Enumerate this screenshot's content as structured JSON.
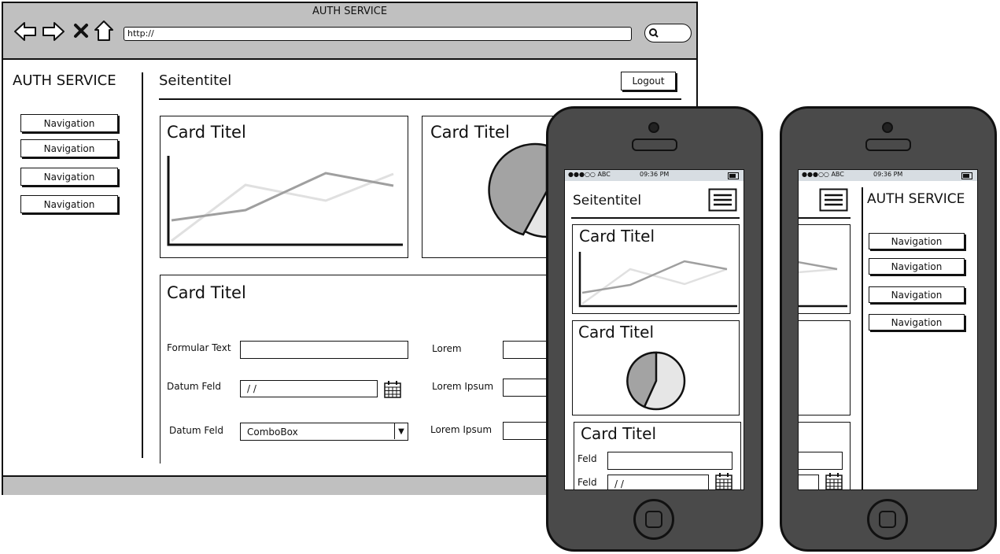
{
  "browser": {
    "window_title": "AUTH SERVICE",
    "url": "http://",
    "toolbar_icons": [
      "back-arrow-icon",
      "forward-arrow-icon",
      "close-x-icon",
      "home-icon",
      "search-icon"
    ]
  },
  "desktop": {
    "app_title": "AUTH SERVICE",
    "page_title": "Seitentitel",
    "logout_label": "Logout",
    "nav_items": [
      "Navigation",
      "Navigation",
      "Navigation",
      "Navigation"
    ],
    "line_card": {
      "title": "Card Titel"
    },
    "pie_card": {
      "title": "Card Titel"
    },
    "form_card": {
      "title": "Card Titel",
      "left_fields": [
        {
          "label": "Formular Text",
          "value": ""
        },
        {
          "label": "Datum Feld",
          "value": "/ /"
        },
        {
          "label": "Datum Feld",
          "value": "ComboBox"
        }
      ],
      "right_fields": [
        {
          "label": "Lorem",
          "value": ""
        },
        {
          "label": "Lorem Ipsum",
          "value": ""
        },
        {
          "label": "Lorem Ipsum",
          "value": ""
        }
      ]
    }
  },
  "phone1": {
    "status": {
      "carrier": "●●●○○ ABC",
      "time": "09:36 PM"
    },
    "page_title": "Seitentitel",
    "cards": [
      "Card Titel",
      "Card Titel",
      "Card Titel"
    ],
    "fields": [
      {
        "label": "Feld",
        "value": ""
      },
      {
        "label": "Feld",
        "value": "/ /"
      }
    ]
  },
  "phone2": {
    "status": {
      "carrier": "●●●○○ ABC",
      "time": "09:36 PM"
    },
    "app_title": "AUTH SERVICE",
    "nav_items": [
      "Navigation",
      "Navigation",
      "Navigation",
      "Navigation"
    ]
  },
  "colors": {
    "chrome_gray": "#c0c0c0",
    "phone_body": "#4a4a4a",
    "status_bar": "#d7dde2",
    "series_dark": "#9f9f9f",
    "series_light": "#e0e0e0",
    "pie_dark": "#a3a3a3",
    "pie_light": "#e6e6e6"
  }
}
